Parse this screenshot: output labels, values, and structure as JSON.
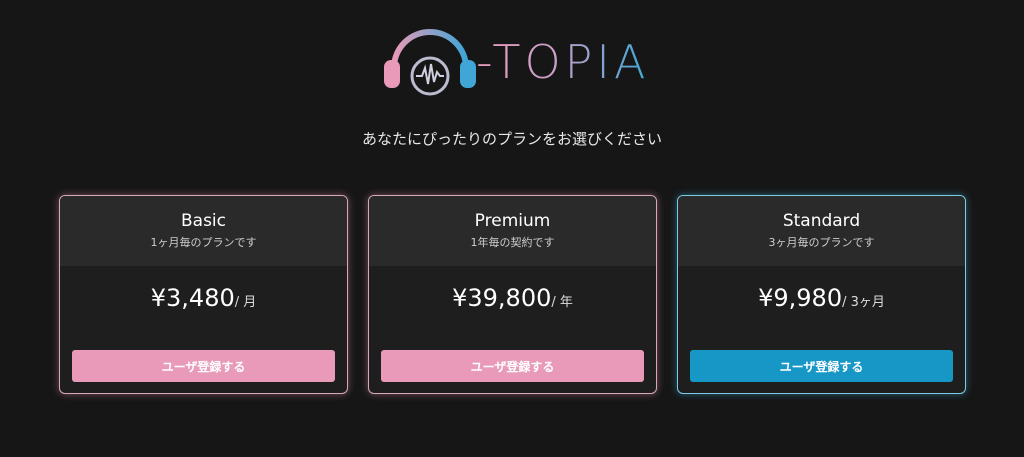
{
  "logo": {
    "text": "-TOPIA",
    "icon": "headphones-icon",
    "colors": {
      "pink": "#e89ab8",
      "blue": "#3fa6d6"
    }
  },
  "tagline": "あなたにぴったりのプランをお選びください",
  "plans": [
    {
      "name": "Basic",
      "description": "1ヶ月毎のプランです",
      "price": "¥3,480",
      "unit": "/ 月",
      "button": "ユーザ登録する",
      "accent": "#e89ab8"
    },
    {
      "name": "Premium",
      "description": "1年毎の契約です",
      "price": "¥39,800",
      "unit": "/ 年",
      "button": "ユーザ登録する",
      "accent": "#e89ab8"
    },
    {
      "name": "Standard",
      "description": "3ヶ月毎のプランです",
      "price": "¥9,980",
      "unit": "/ 3ヶ月",
      "button": "ユーザ登録する",
      "accent": "#1797c6"
    }
  ]
}
